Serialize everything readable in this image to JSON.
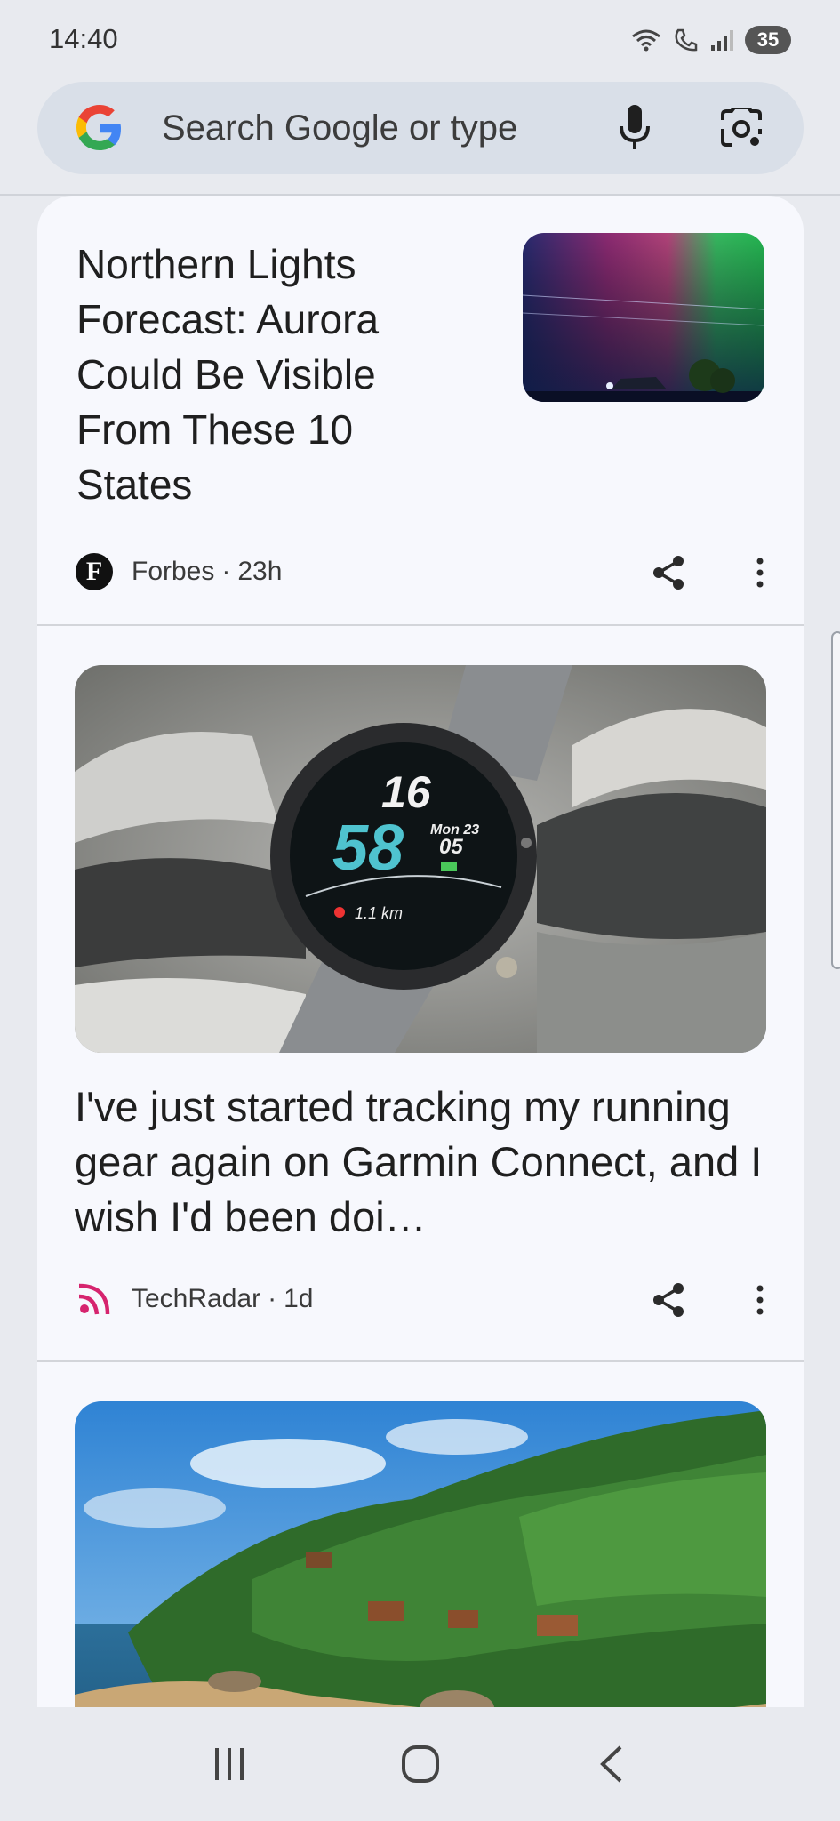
{
  "status_bar": {
    "time": "14:40",
    "battery": "35",
    "icons": [
      "wifi-icon",
      "call-icon",
      "signal-icon",
      "battery-icon"
    ]
  },
  "search": {
    "placeholder": "Search Google or type",
    "icons": [
      "google-logo",
      "mic-icon",
      "lens-icon"
    ]
  },
  "feed": {
    "cards": [
      {
        "headline": "Northern Lights Forecast: Aurora Could Be Visible From These 10 States",
        "source": "Forbes",
        "separator": "·",
        "age": "23h"
      },
      {
        "headline": "I've just started tracking my running gear again on Garmin Connect, and I wish I'd been doi…",
        "source": "TechRadar",
        "separator": "·",
        "age": "1d"
      },
      {
        "headline": "",
        "source": "",
        "age": ""
      }
    ]
  },
  "nav_bar": {
    "icons": [
      "recent-apps-icon",
      "home-icon",
      "back-icon"
    ]
  },
  "colors": {
    "background": "#e8eaef",
    "card": "#f7f8fd",
    "search_bar": "#d9dfe8",
    "techradar_accent": "#d6246e"
  }
}
